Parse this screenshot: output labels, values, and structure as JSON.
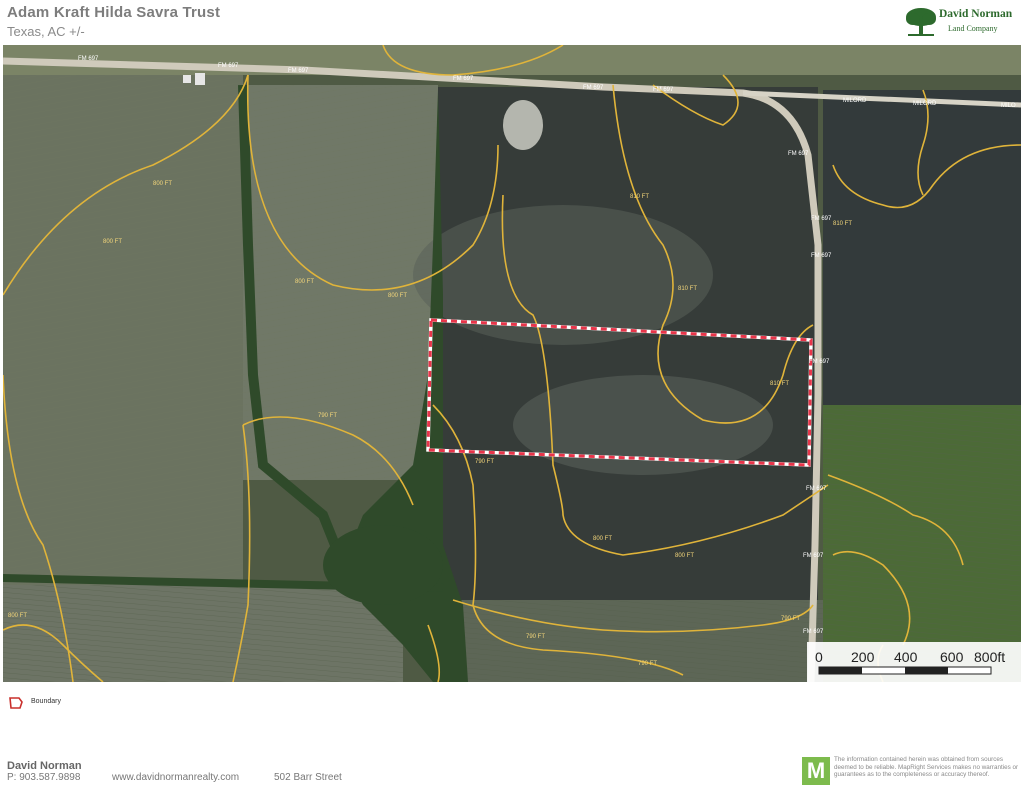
{
  "header": {
    "title": "Adam Kraft Hilda Savra Trust",
    "subtitle": "Texas,  AC +/-"
  },
  "brand": {
    "name": "David Norman",
    "sub": "Land Company",
    "color": "#2d6a2d"
  },
  "map": {
    "road_labels": [
      "FM 697",
      "MILORD",
      "MILORD",
      "MILO"
    ],
    "contour_labels": [
      "800 FT",
      "810 FT",
      "790 FT"
    ],
    "boundary_color": "#e8354a",
    "contour_color": "#e0b43a",
    "scale_bar": {
      "ticks": [
        "0",
        "200",
        "400",
        "600",
        "800ft"
      ]
    }
  },
  "legend": {
    "boundary_label": "Boundary"
  },
  "footer": {
    "name": "David Norman",
    "phone": "P: 903.587.9898",
    "website": "www.davidnormanrealty.com",
    "address": "502 Barr Street",
    "logo_letter": "M",
    "disclaimer": "The information contained herein was obtained from sources deemed to be reliable. MapRight Services makes no warranties or guarantees as to the completeness or accuracy thereof."
  }
}
